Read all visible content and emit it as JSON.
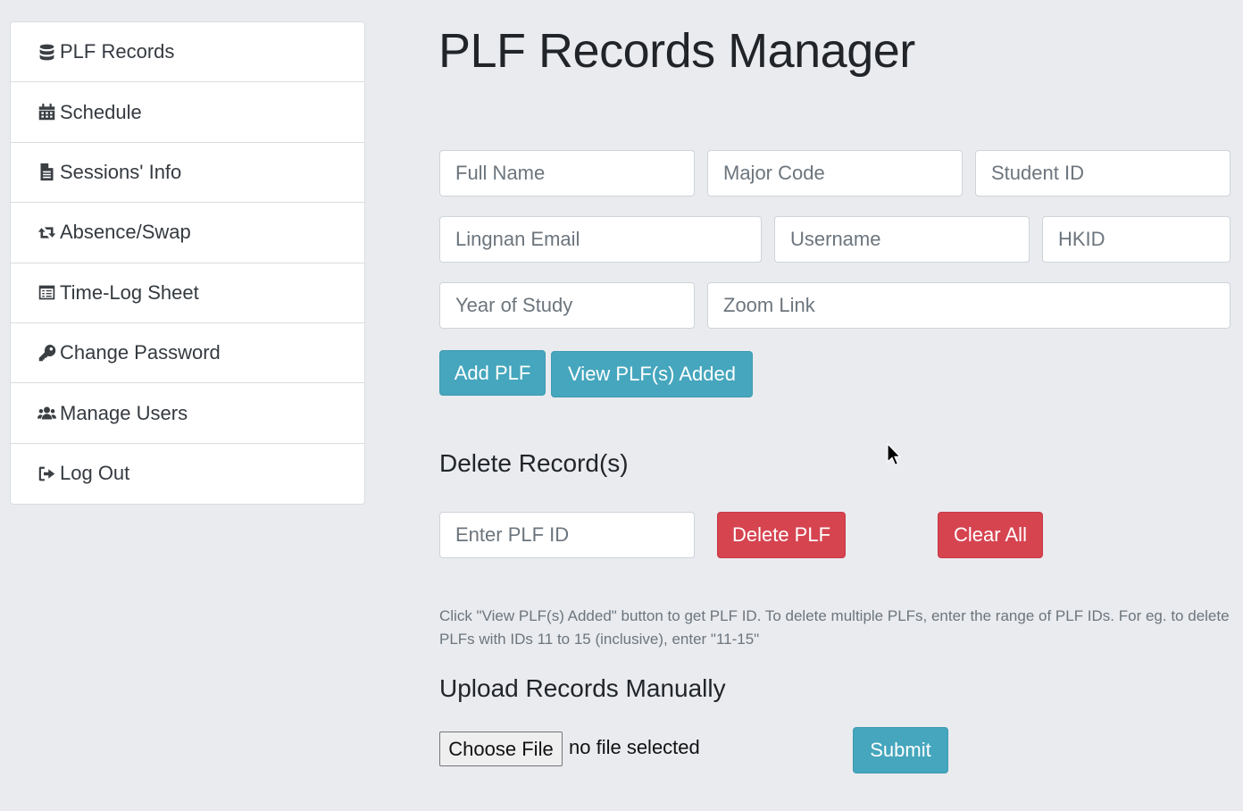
{
  "sidebar": {
    "items": [
      {
        "label": "PLF Records",
        "icon": "database-icon"
      },
      {
        "label": "Schedule",
        "icon": "calendar-icon"
      },
      {
        "label": "Sessions' Info",
        "icon": "file-text-icon"
      },
      {
        "label": "Absence/Swap",
        "icon": "retweet-icon"
      },
      {
        "label": "Time-Log Sheet",
        "icon": "timesheet-icon"
      },
      {
        "label": "Change Password",
        "icon": "key-icon"
      },
      {
        "label": "Manage Users",
        "icon": "users-icon"
      },
      {
        "label": "Log Out",
        "icon": "sign-out-icon"
      }
    ]
  },
  "main": {
    "title": "PLF Records Manager",
    "add_form": {
      "full_name_placeholder": "Full Name",
      "major_code_placeholder": "Major Code",
      "student_id_placeholder": "Student ID",
      "email_placeholder": "Lingnan Email",
      "username_placeholder": "Username",
      "hkid_placeholder": "HKID",
      "year_placeholder": "Year of Study",
      "zoom_placeholder": "Zoom Link",
      "add_label": "Add PLF",
      "view_label": "View PLF(s) Added"
    },
    "delete_section": {
      "heading": "Delete Record(s)",
      "id_placeholder": "Enter PLF ID",
      "delete_label": "Delete PLF",
      "clear_label": "Clear All",
      "help_text": "Click \"View PLF(s) Added\" button to get PLF ID. To delete multiple PLFs, enter the range of PLF IDs. For eg. to delete PLFs with IDs 11 to 15 (inclusive), enter \"11-15\""
    },
    "upload_section": {
      "heading": "Upload Records Manually",
      "choose_file_label": "Choose File",
      "file_status": "no file selected",
      "submit_label": "Submit"
    }
  },
  "colors": {
    "info": "#45a6bd",
    "danger": "#d64450",
    "background": "#e9ebef"
  }
}
